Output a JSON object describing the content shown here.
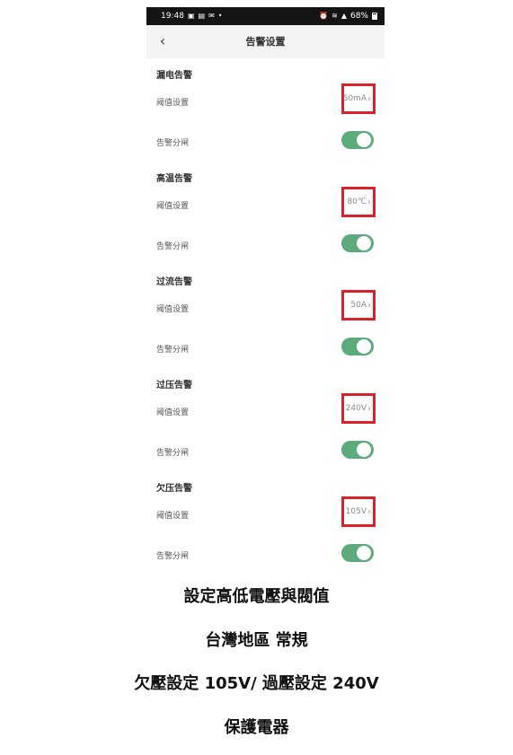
{
  "status_bar": {
    "time": "19:48",
    "battery": "68%"
  },
  "header": {
    "title": "告警设置"
  },
  "labels": {
    "threshold": "阈值设置",
    "trip": "告警分闸"
  },
  "colors": {
    "highlight": "#d9232a",
    "toggle_on": "#5daa7d"
  },
  "alarms": [
    {
      "title": "漏电告警",
      "value": "50mA",
      "trip_on": true
    },
    {
      "title": "高温告警",
      "value": "80℃",
      "trip_on": true
    },
    {
      "title": "过流告警",
      "value": "50A",
      "trip_on": true
    },
    {
      "title": "过压告警",
      "value": "240V",
      "trip_on": true
    },
    {
      "title": "欠压告警",
      "value": "105V",
      "trip_on": true
    }
  ],
  "captions": [
    "設定高低電壓與閥值",
    "台灣地區 常規",
    "欠壓設定 105V/ 過壓設定 240V",
    "保護電器"
  ]
}
